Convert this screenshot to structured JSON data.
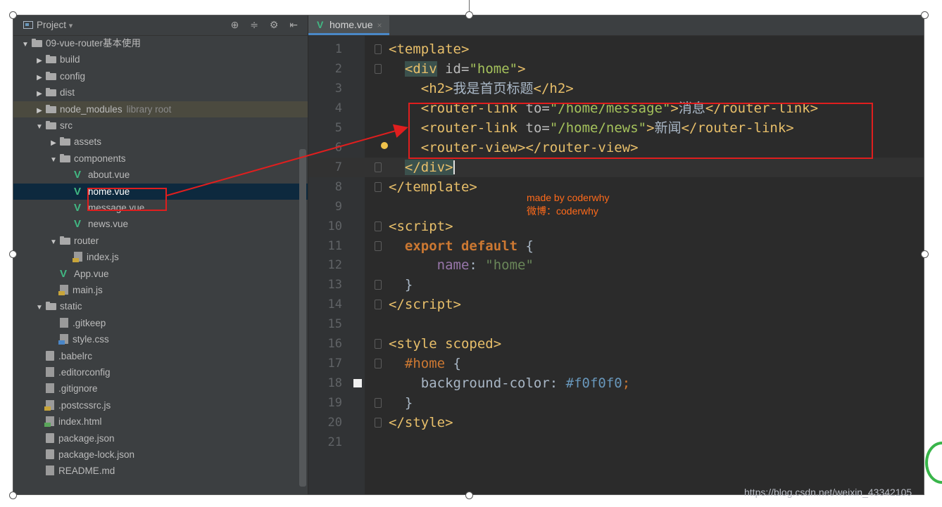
{
  "project_panel": {
    "title": "Project",
    "dropdown_arrow": "▾",
    "tools": "⊕ ≑ ⚙ ⇤"
  },
  "tree": [
    {
      "label": "09-vue-router基本使用",
      "icon": "folder-icon",
      "arrow": "▼",
      "level": 1
    },
    {
      "label": "build",
      "icon": "folder-icon",
      "arrow": "▶",
      "level": 2
    },
    {
      "label": "config",
      "icon": "folder-icon",
      "arrow": "▶",
      "level": 2
    },
    {
      "label": "dist",
      "icon": "folder-icon",
      "arrow": "▶",
      "level": 2
    },
    {
      "label": "node_modules",
      "extra": "library root",
      "icon": "folder-icon",
      "arrow": "▶",
      "level": 2
    },
    {
      "label": "src",
      "icon": "folder-icon",
      "arrow": "▼",
      "level": 2
    },
    {
      "label": "assets",
      "icon": "folder-icon",
      "arrow": "▶",
      "level": 3
    },
    {
      "label": "components",
      "icon": "folder-icon",
      "arrow": "▼",
      "level": 3
    },
    {
      "label": "about.vue",
      "icon": "vue-icon",
      "level": 4
    },
    {
      "label": "home.vue",
      "icon": "vue-icon",
      "level": 4,
      "selected": true
    },
    {
      "label": "message.vue",
      "icon": "vue-icon",
      "level": 4
    },
    {
      "label": "news.vue",
      "icon": "vue-icon",
      "level": 4
    },
    {
      "label": "router",
      "icon": "folder-icon",
      "arrow": "▼",
      "level": 3
    },
    {
      "label": "index.js",
      "icon": "js-file-icon",
      "level": 4
    },
    {
      "label": "App.vue",
      "icon": "vue-icon",
      "level": 3
    },
    {
      "label": "main.js",
      "icon": "js-file-icon",
      "level": 3
    },
    {
      "label": "static",
      "icon": "folder-icon",
      "arrow": "▼",
      "level": 2
    },
    {
      "label": ".gitkeep",
      "icon": "file-icon",
      "level": 3
    },
    {
      "label": "style.css",
      "icon": "css-file-icon",
      "level": 3
    },
    {
      "label": ".babelrc",
      "icon": "config-file-icon",
      "level": 2
    },
    {
      "label": ".editorconfig",
      "icon": "file-icon",
      "level": 2
    },
    {
      "label": ".gitignore",
      "icon": "file-icon",
      "level": 2
    },
    {
      "label": ".postcssrc.js",
      "icon": "js-file-icon",
      "level": 2
    },
    {
      "label": "index.html",
      "icon": "html-file-icon",
      "level": 2
    },
    {
      "label": "package.json",
      "icon": "config-file-icon",
      "level": 2
    },
    {
      "label": "package-lock.json",
      "icon": "config-file-icon",
      "level": 2
    },
    {
      "label": "README.md",
      "icon": "file-icon",
      "level": 2
    }
  ],
  "editor": {
    "tab_label": "home.vue",
    "tab_close": "×"
  },
  "code_lines": [
    {
      "n": "1",
      "html": "<span class='tag'>&lt;template&gt;</span>"
    },
    {
      "n": "2",
      "html": "  <span class='tag hl'>&lt;div</span> <span class='attr'>id=</span><span class='val'>\"home\"</span><span class='tag'>&gt;</span>"
    },
    {
      "n": "3",
      "html": "    <span class='tag'>&lt;h2&gt;</span>我是首页标题<span class='tag'>&lt;/h2&gt;</span>"
    },
    {
      "n": "4",
      "html": "    <span class='tag'>&lt;router-link</span> <span class='attr'>to=</span><span class='val'>\"/home/message\"</span><span class='tag'>&gt;</span>消息<span class='tag'>&lt;/router-link&gt;</span>"
    },
    {
      "n": "5",
      "html": "    <span class='tag'>&lt;router-link</span> <span class='attr'>to=</span><span class='val'>\"/home/news\"</span><span class='tag'>&gt;</span>新闻<span class='tag'>&lt;/router-link&gt;</span>"
    },
    {
      "n": "6",
      "html": "    <span class='tag'>&lt;router-view&gt;&lt;/router-view&gt;</span>"
    },
    {
      "n": "7",
      "html": "  <span class='tag hl'>&lt;/div&gt;</span><span class='caret'></span>"
    },
    {
      "n": "8",
      "html": "<span class='tag'>&lt;/template&gt;</span>"
    },
    {
      "n": "9",
      "html": ""
    },
    {
      "n": "10",
      "html": "<span class='tag'>&lt;script&gt;</span>"
    },
    {
      "n": "11",
      "html": "  <span class='kw'>export default</span> {"
    },
    {
      "n": "12",
      "html": "      <span class='prop'>name</span>: <span class='str'>\"home\"</span>"
    },
    {
      "n": "13",
      "html": "  }"
    },
    {
      "n": "14",
      "html": "<span class='tag'>&lt;/script&gt;</span>"
    },
    {
      "n": "15",
      "html": ""
    },
    {
      "n": "16",
      "html": "<span class='tag'>&lt;style scoped&gt;</span>"
    },
    {
      "n": "17",
      "html": "  <span class='sel2'>#home</span> {"
    },
    {
      "n": "18",
      "html": "    background-color: <span class='num'>#f0f0f0</span><span class='sel2'>;</span>"
    },
    {
      "n": "19",
      "html": "  }"
    },
    {
      "n": "20",
      "html": "<span class='tag'>&lt;/style&gt;</span>"
    },
    {
      "n": "21",
      "html": ""
    }
  ],
  "annotation": {
    "credit_line1": "made by coderwhy",
    "credit_line2": "微博：coderwhy",
    "color": "#e01e1e"
  },
  "watermark": "https://blog.csdn.net/weixin_43342105"
}
